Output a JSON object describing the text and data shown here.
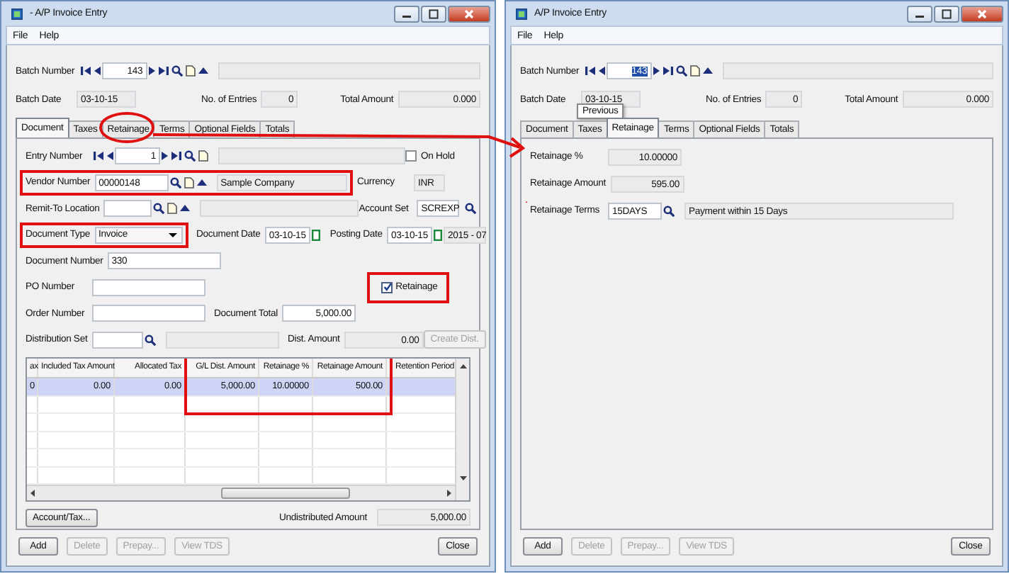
{
  "windows": [
    {
      "title": "- A/P Invoice Entry",
      "menu": [
        {
          "label": "File"
        },
        {
          "label": "Help"
        }
      ],
      "batch_number": {
        "label": "Batch Number",
        "value": "143",
        "selected": false
      },
      "batch_date": {
        "label": "Batch Date",
        "value": "03-10-15"
      },
      "entries": {
        "label": "No. of Entries",
        "value": "0"
      },
      "total": {
        "label": "Total Amount",
        "value": "0.000"
      },
      "tabs": [
        {
          "label": "Document",
          "selected": true
        },
        {
          "label": "Taxes",
          "selected": false
        },
        {
          "label": "Retainage",
          "selected": false
        },
        {
          "label": "Terms",
          "selected": false
        },
        {
          "label": "Optional Fields",
          "selected": false
        },
        {
          "label": "Totals",
          "selected": false
        }
      ],
      "content": {
        "kind": "document",
        "entry_number": {
          "label": "Entry Number",
          "value": "1"
        },
        "on_hold": {
          "label": "On Hold",
          "checked": false
        },
        "vendor": {
          "label": "Vendor Number",
          "value": "00000148",
          "name": "Sample Company"
        },
        "currency": {
          "label": "Currency",
          "value": "INR"
        },
        "remit_to": {
          "label": "Remit-To Location"
        },
        "account_set": {
          "label": "Account Set",
          "value": "SCREXP"
        },
        "document_type": {
          "label": "Document Type",
          "value": "Invoice"
        },
        "document_date": {
          "label": "Document Date",
          "value": "03-10-15"
        },
        "posting_date": {
          "label": "Posting Date",
          "value": "03-10-15"
        },
        "period": "2015 - 07",
        "document_number": {
          "label": "Document Number",
          "value": "330"
        },
        "po_number": {
          "label": "PO Number"
        },
        "retainage": {
          "label": "Retainage",
          "checked": true
        },
        "order_number": {
          "label": "Order Number"
        },
        "document_total": {
          "label": "Document Total",
          "value": "5,000.00"
        },
        "distribution_set": {
          "label": "Distribution Set"
        },
        "dist_amount": {
          "label": "Dist. Amount",
          "value": "0.00"
        },
        "create_dist": {
          "label": "Create Dist.",
          "disabled": true
        },
        "table": {
          "columns": [
            "ax",
            "Included Tax Amount",
            "Allocated Tax",
            "G/L Dist. Amount",
            "Retainage %",
            "Retainage Amount",
            "Retention Period"
          ],
          "rows": [
            {
              "cells": [
                "0",
                "0.00",
                "0.00",
                "5,000.00",
                "10.00000",
                "500.00"
              ],
              "selected": true
            }
          ]
        },
        "account_tax": "Account/Tax...",
        "undistributed": {
          "label": "Undistributed Amount",
          "value": "5,000.00"
        }
      },
      "buttons": [
        {
          "label": "Add",
          "disabled": false
        },
        {
          "label": "Delete",
          "disabled": true
        },
        {
          "label": "Prepay...",
          "disabled": true
        },
        {
          "label": "View TDS",
          "disabled": true
        }
      ],
      "close_button": "Close"
    },
    {
      "title": "A/P Invoice Entry",
      "menu": [
        {
          "label": "File"
        },
        {
          "label": "Help"
        }
      ],
      "batch_number": {
        "label": "Batch Number",
        "value": "143",
        "selected": true
      },
      "tooltip": "Previous",
      "batch_date": {
        "label": "Batch Date",
        "value": "03-10-15"
      },
      "entries": {
        "label": "No. of Entries",
        "value": "0"
      },
      "total": {
        "label": "Total Amount",
        "value": "0.000"
      },
      "tabs": [
        {
          "label": "Document",
          "selected": false
        },
        {
          "label": "Taxes",
          "selected": false
        },
        {
          "label": "Retainage",
          "selected": true
        },
        {
          "label": "Terms",
          "selected": false
        },
        {
          "label": "Optional Fields",
          "selected": false
        },
        {
          "label": "Totals",
          "selected": false
        }
      ],
      "content": {
        "kind": "retainage",
        "retainage_percent": {
          "label": "Retainage %",
          "value": "10.00000"
        },
        "retainage_amount": {
          "label": "Retainage Amount",
          "value": "595.00"
        },
        "retainage_terms": {
          "label": "Retainage Terms",
          "value": "15DAYS",
          "description": "Payment within 15 Days"
        }
      },
      "buttons": [
        {
          "label": "Add",
          "disabled": false
        },
        {
          "label": "Delete",
          "disabled": true
        },
        {
          "label": "Prepay...",
          "disabled": true
        },
        {
          "label": "View TDS",
          "disabled": true
        }
      ],
      "close_button": "Close"
    }
  ]
}
